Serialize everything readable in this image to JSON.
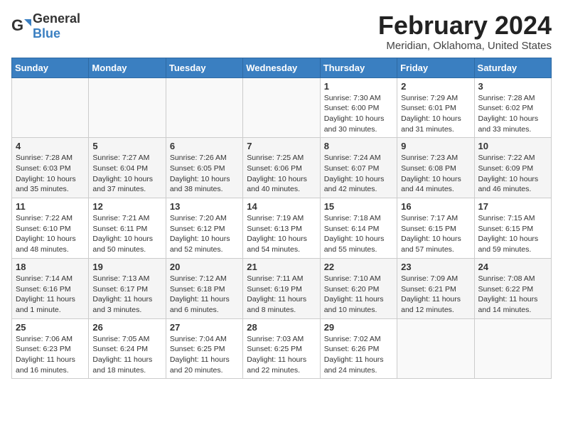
{
  "header": {
    "logo_general": "General",
    "logo_blue": "Blue",
    "month": "February 2024",
    "location": "Meridian, Oklahoma, United States"
  },
  "weekdays": [
    "Sunday",
    "Monday",
    "Tuesday",
    "Wednesday",
    "Thursday",
    "Friday",
    "Saturday"
  ],
  "weeks": [
    [
      {
        "day": "",
        "info": ""
      },
      {
        "day": "",
        "info": ""
      },
      {
        "day": "",
        "info": ""
      },
      {
        "day": "",
        "info": ""
      },
      {
        "day": "1",
        "info": "Sunrise: 7:30 AM\nSunset: 6:00 PM\nDaylight: 10 hours\nand 30 minutes."
      },
      {
        "day": "2",
        "info": "Sunrise: 7:29 AM\nSunset: 6:01 PM\nDaylight: 10 hours\nand 31 minutes."
      },
      {
        "day": "3",
        "info": "Sunrise: 7:28 AM\nSunset: 6:02 PM\nDaylight: 10 hours\nand 33 minutes."
      }
    ],
    [
      {
        "day": "4",
        "info": "Sunrise: 7:28 AM\nSunset: 6:03 PM\nDaylight: 10 hours\nand 35 minutes."
      },
      {
        "day": "5",
        "info": "Sunrise: 7:27 AM\nSunset: 6:04 PM\nDaylight: 10 hours\nand 37 minutes."
      },
      {
        "day": "6",
        "info": "Sunrise: 7:26 AM\nSunset: 6:05 PM\nDaylight: 10 hours\nand 38 minutes."
      },
      {
        "day": "7",
        "info": "Sunrise: 7:25 AM\nSunset: 6:06 PM\nDaylight: 10 hours\nand 40 minutes."
      },
      {
        "day": "8",
        "info": "Sunrise: 7:24 AM\nSunset: 6:07 PM\nDaylight: 10 hours\nand 42 minutes."
      },
      {
        "day": "9",
        "info": "Sunrise: 7:23 AM\nSunset: 6:08 PM\nDaylight: 10 hours\nand 44 minutes."
      },
      {
        "day": "10",
        "info": "Sunrise: 7:22 AM\nSunset: 6:09 PM\nDaylight: 10 hours\nand 46 minutes."
      }
    ],
    [
      {
        "day": "11",
        "info": "Sunrise: 7:22 AM\nSunset: 6:10 PM\nDaylight: 10 hours\nand 48 minutes."
      },
      {
        "day": "12",
        "info": "Sunrise: 7:21 AM\nSunset: 6:11 PM\nDaylight: 10 hours\nand 50 minutes."
      },
      {
        "day": "13",
        "info": "Sunrise: 7:20 AM\nSunset: 6:12 PM\nDaylight: 10 hours\nand 52 minutes."
      },
      {
        "day": "14",
        "info": "Sunrise: 7:19 AM\nSunset: 6:13 PM\nDaylight: 10 hours\nand 54 minutes."
      },
      {
        "day": "15",
        "info": "Sunrise: 7:18 AM\nSunset: 6:14 PM\nDaylight: 10 hours\nand 55 minutes."
      },
      {
        "day": "16",
        "info": "Sunrise: 7:17 AM\nSunset: 6:15 PM\nDaylight: 10 hours\nand 57 minutes."
      },
      {
        "day": "17",
        "info": "Sunrise: 7:15 AM\nSunset: 6:15 PM\nDaylight: 10 hours\nand 59 minutes."
      }
    ],
    [
      {
        "day": "18",
        "info": "Sunrise: 7:14 AM\nSunset: 6:16 PM\nDaylight: 11 hours\nand 1 minute."
      },
      {
        "day": "19",
        "info": "Sunrise: 7:13 AM\nSunset: 6:17 PM\nDaylight: 11 hours\nand 3 minutes."
      },
      {
        "day": "20",
        "info": "Sunrise: 7:12 AM\nSunset: 6:18 PM\nDaylight: 11 hours\nand 6 minutes."
      },
      {
        "day": "21",
        "info": "Sunrise: 7:11 AM\nSunset: 6:19 PM\nDaylight: 11 hours\nand 8 minutes."
      },
      {
        "day": "22",
        "info": "Sunrise: 7:10 AM\nSunset: 6:20 PM\nDaylight: 11 hours\nand 10 minutes."
      },
      {
        "day": "23",
        "info": "Sunrise: 7:09 AM\nSunset: 6:21 PM\nDaylight: 11 hours\nand 12 minutes."
      },
      {
        "day": "24",
        "info": "Sunrise: 7:08 AM\nSunset: 6:22 PM\nDaylight: 11 hours\nand 14 minutes."
      }
    ],
    [
      {
        "day": "25",
        "info": "Sunrise: 7:06 AM\nSunset: 6:23 PM\nDaylight: 11 hours\nand 16 minutes."
      },
      {
        "day": "26",
        "info": "Sunrise: 7:05 AM\nSunset: 6:24 PM\nDaylight: 11 hours\nand 18 minutes."
      },
      {
        "day": "27",
        "info": "Sunrise: 7:04 AM\nSunset: 6:25 PM\nDaylight: 11 hours\nand 20 minutes."
      },
      {
        "day": "28",
        "info": "Sunrise: 7:03 AM\nSunset: 6:25 PM\nDaylight: 11 hours\nand 22 minutes."
      },
      {
        "day": "29",
        "info": "Sunrise: 7:02 AM\nSunset: 6:26 PM\nDaylight: 11 hours\nand 24 minutes."
      },
      {
        "day": "",
        "info": ""
      },
      {
        "day": "",
        "info": ""
      }
    ]
  ]
}
